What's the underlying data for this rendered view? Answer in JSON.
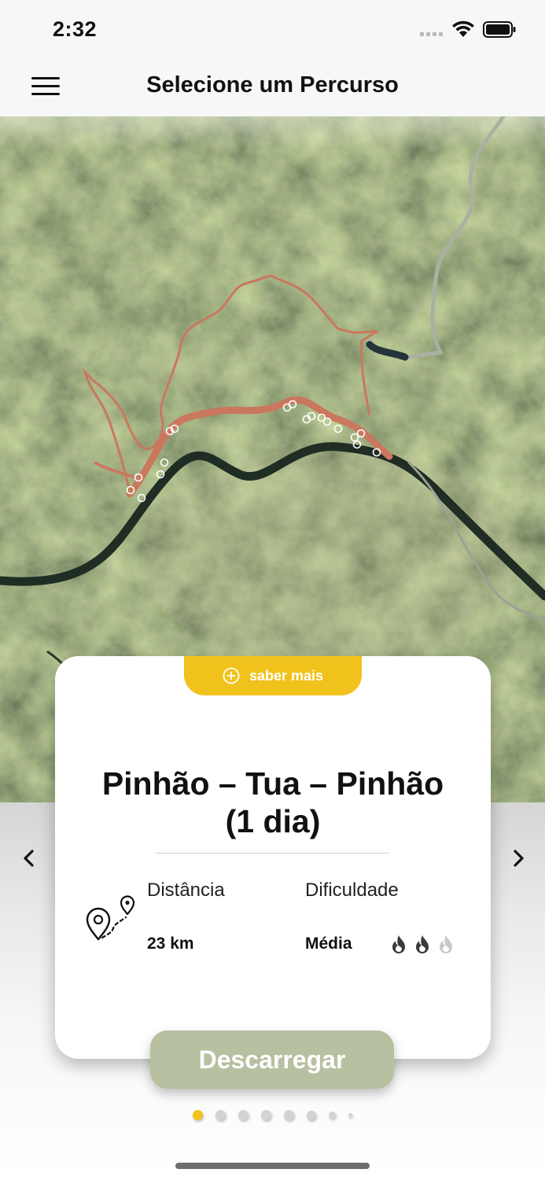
{
  "status_bar": {
    "time": "2:32"
  },
  "nav": {
    "title": "Selecione um Percurso",
    "menu_icon": "hamburger-menu-icon"
  },
  "card": {
    "saber_mais": "saber mais",
    "title_line1": "Pinhão – Tua – Pinhão",
    "title_line2": "(1 dia)",
    "distance_label": "Distância",
    "distance_value": "23 km",
    "difficulty_label": "Dificuldade",
    "difficulty_value": "Média",
    "difficulty_level": 2,
    "difficulty_max": 3
  },
  "download_button": "Descarregar",
  "pagination": {
    "pages": 8,
    "current": 1
  },
  "colors": {
    "accent_yellow": "#f1c21b",
    "download_green": "#b7c0a0",
    "route_color": "#c9785e"
  }
}
